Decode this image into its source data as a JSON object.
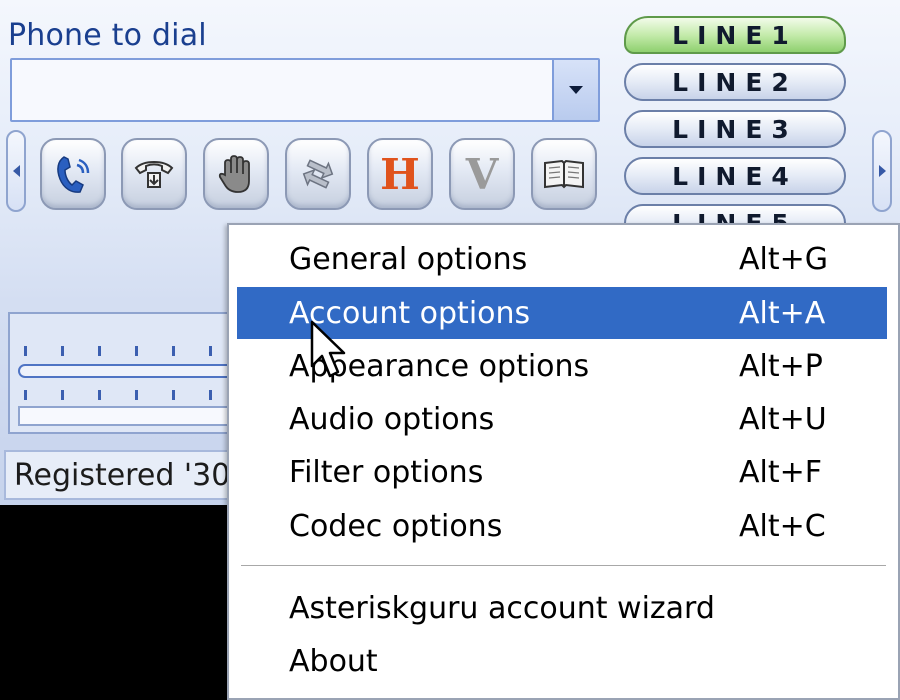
{
  "phone": {
    "dial_label": "Phone to dial",
    "dial_value": "",
    "toolbar": [
      {
        "name": "dial-button",
        "icon": "handset-icon"
      },
      {
        "name": "hangup-button",
        "icon": "telephone-icon"
      },
      {
        "name": "hold-button",
        "icon": "hand-icon"
      },
      {
        "name": "transfer-button",
        "icon": "transfer-arrows-icon"
      },
      {
        "name": "h-button",
        "icon": "letter-h-icon",
        "glyph": "H",
        "color": "#e0531c"
      },
      {
        "name": "v-button",
        "icon": "letter-v-icon",
        "glyph": "V",
        "color": "#9a9a9a"
      },
      {
        "name": "phonebook-button",
        "icon": "book-icon"
      }
    ],
    "lines": [
      {
        "label": "LINE1",
        "active": true
      },
      {
        "label": "LINE2",
        "active": false
      },
      {
        "label": "LINE3",
        "active": false
      },
      {
        "label": "LINE4",
        "active": false
      },
      {
        "label": "LINE5",
        "active": false
      }
    ],
    "status": "Registered '30"
  },
  "menu": {
    "items": [
      {
        "label": "General options",
        "shortcut": "Alt+G"
      },
      {
        "label": "Account options",
        "shortcut": "Alt+A"
      },
      {
        "label": "Appearance options",
        "shortcut": "Alt+P"
      },
      {
        "label": "Audio options",
        "shortcut": "Alt+U"
      },
      {
        "label": "Filter options",
        "shortcut": "Alt+F"
      },
      {
        "label": "Codec options",
        "shortcut": "Alt+C"
      }
    ],
    "items2": [
      {
        "label": "Asteriskguru account wizard"
      },
      {
        "label": "About"
      }
    ],
    "highlighted_index": 1,
    "highlight_color": "#316ac5"
  }
}
